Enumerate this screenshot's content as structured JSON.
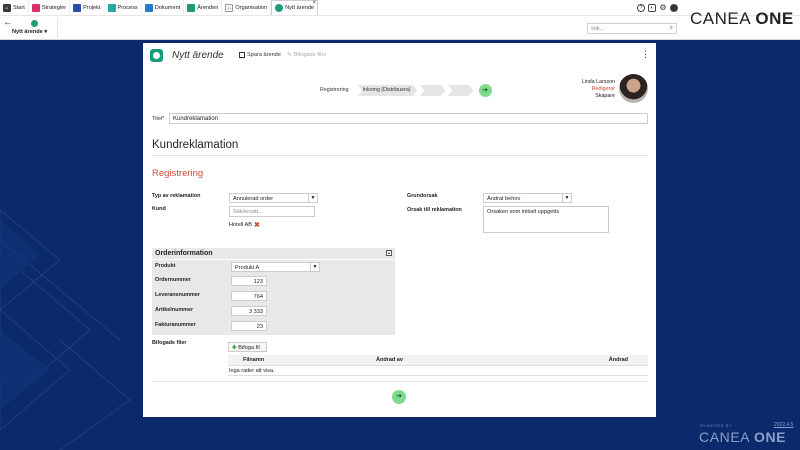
{
  "nav": {
    "tabs": [
      {
        "label": "Start",
        "icon": "home-icon",
        "color": "#3a3a3a"
      },
      {
        "label": "Strategier",
        "icon": "strategy-icon",
        "color": "#d6336c"
      },
      {
        "label": "Projekt",
        "icon": "project-icon",
        "color": "#2d4ea8"
      },
      {
        "label": "Process",
        "icon": "process-icon",
        "color": "#2aa8a0"
      },
      {
        "label": "Dokument",
        "icon": "document-icon",
        "color": "#2b78c4"
      },
      {
        "label": "Ärenden",
        "icon": "case-icon",
        "color": "#1a9c7a"
      },
      {
        "label": "Organisation",
        "icon": "organisation-icon",
        "color": "#555555"
      },
      {
        "label": "Nytt ärende",
        "icon": "case-icon",
        "color": "#1a9c7a"
      }
    ],
    "sub_tab_label": "Nytt ärende",
    "search_placeholder": "sök...",
    "brand_a": "CANEA ",
    "brand_b": "ONE"
  },
  "footer": {
    "powered_by": "POWERED BY",
    "logo_a": "CANEA ",
    "logo_b": "ONE",
    "version": "2022.4.5"
  },
  "panel": {
    "title": "Nytt ärende",
    "save_label": "Spara ärende",
    "attach_label": "Bifogade filer",
    "steps": [
      "Registrering",
      "Inkomg (Distribuera)",
      "",
      ""
    ],
    "user": {
      "name": "Linda Larsson",
      "action": "Redigerar",
      "role": "Skapare"
    },
    "title_label": "Titel*",
    "title_value": "Kundreklamation",
    "heading": "Kundreklamation",
    "section": "Registrering",
    "fields": {
      "typ_label": "Typ av reklamation",
      "typ_value": "Annulerad order",
      "kund_label": "Kund",
      "kund_placeholder": "Sök/ersätt...",
      "kund_value": "Hotell AB",
      "grundorsak_label": "Grundorsak",
      "grundorsak_value": "Ändrat behov",
      "orsak_label": "Orsak till reklamation",
      "orsak_value": "Orsaken som initialt uppgetts"
    },
    "order": {
      "title": "Orderinformation",
      "produkt_label": "Produkt",
      "produkt_value": "Produkt A",
      "ordernummer_label": "Ordernummer",
      "ordernummer_value": "123",
      "leverans_label": "Leveransnummer",
      "leverans_value": "764",
      "artikel_label": "Artikelnummer",
      "artikel_value": "3 333",
      "faktura_label": "Fakturanummer",
      "faktura_value": "23"
    },
    "attachments": {
      "label": "Bifogade filer",
      "button": "Bifoga fil",
      "columns": [
        "Filnamn",
        "Ändrad av",
        "Ändrad"
      ],
      "empty": "Inga rader att visa."
    }
  }
}
